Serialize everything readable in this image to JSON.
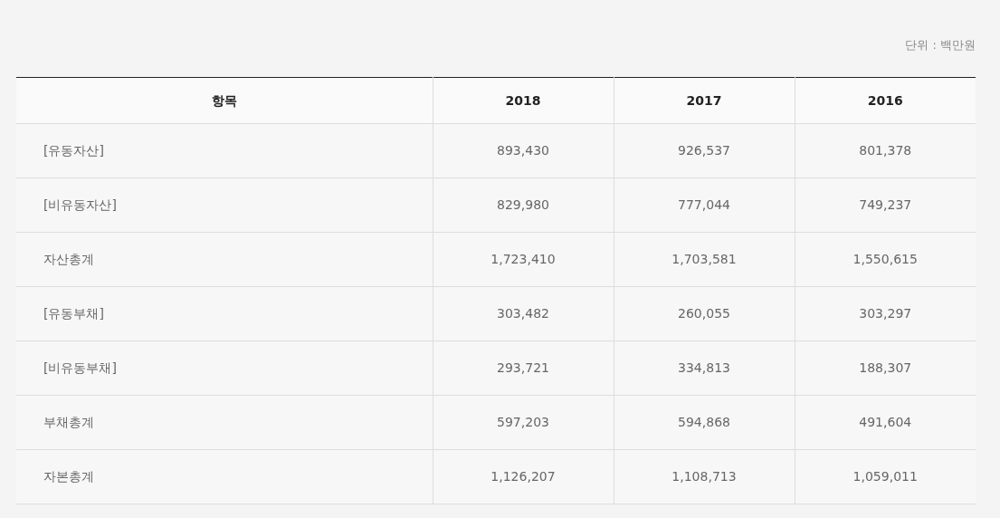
{
  "unit_label": "단위 : 백만원",
  "table": {
    "columns": [
      "항목",
      "2018",
      "2017",
      "2016"
    ],
    "rows": [
      [
        "[유동자산]",
        "893,430",
        "926,537",
        "801,378"
      ],
      [
        "[비유동자산]",
        "829,980",
        "777,044",
        "749,237"
      ],
      [
        "자산총계",
        "1,723,410",
        "1,703,581",
        "1,550,615"
      ],
      [
        "[유동부채]",
        "303,482",
        "260,055",
        "303,297"
      ],
      [
        "[비유동부채]",
        "293,721",
        "334,813",
        "188,307"
      ],
      [
        "부채총계",
        "597,203",
        "594,868",
        "491,604"
      ],
      [
        "자본총계",
        "1,126,207",
        "1,108,713",
        "1,059,011"
      ]
    ]
  }
}
